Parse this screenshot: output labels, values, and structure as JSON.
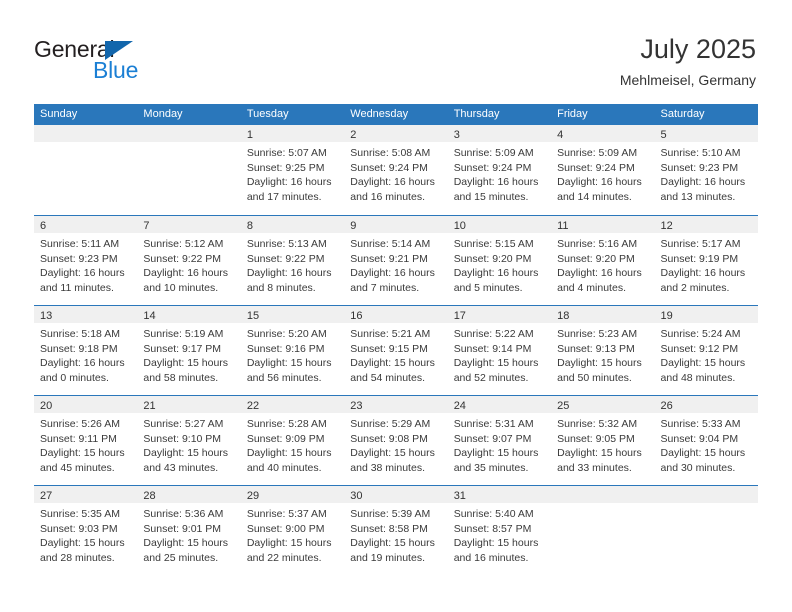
{
  "brand": {
    "name_part1": "General",
    "name_part2": "Blue",
    "flag_icon": "blue-triangle-flag-icon"
  },
  "header": {
    "title": "July 2025",
    "location": "Mehlmeisel, Germany"
  },
  "colors": {
    "header_blue": "#2a77bb",
    "brand_blue": "#1b7fd4",
    "flag_blue": "#1266ac",
    "day_band_gray": "#f0f0f0",
    "text_dark": "#333333"
  },
  "weekdays": [
    "Sunday",
    "Monday",
    "Tuesday",
    "Wednesday",
    "Thursday",
    "Friday",
    "Saturday"
  ],
  "weeks": [
    [
      {
        "day": "",
        "empty": true
      },
      {
        "day": "",
        "empty": true
      },
      {
        "day": "1",
        "sunrise": "Sunrise: 5:07 AM",
        "sunset": "Sunset: 9:25 PM",
        "daylight": "Daylight: 16 hours and 17 minutes."
      },
      {
        "day": "2",
        "sunrise": "Sunrise: 5:08 AM",
        "sunset": "Sunset: 9:24 PM",
        "daylight": "Daylight: 16 hours and 16 minutes."
      },
      {
        "day": "3",
        "sunrise": "Sunrise: 5:09 AM",
        "sunset": "Sunset: 9:24 PM",
        "daylight": "Daylight: 16 hours and 15 minutes."
      },
      {
        "day": "4",
        "sunrise": "Sunrise: 5:09 AM",
        "sunset": "Sunset: 9:24 PM",
        "daylight": "Daylight: 16 hours and 14 minutes."
      },
      {
        "day": "5",
        "sunrise": "Sunrise: 5:10 AM",
        "sunset": "Sunset: 9:23 PM",
        "daylight": "Daylight: 16 hours and 13 minutes."
      }
    ],
    [
      {
        "day": "6",
        "sunrise": "Sunrise: 5:11 AM",
        "sunset": "Sunset: 9:23 PM",
        "daylight": "Daylight: 16 hours and 11 minutes."
      },
      {
        "day": "7",
        "sunrise": "Sunrise: 5:12 AM",
        "sunset": "Sunset: 9:22 PM",
        "daylight": "Daylight: 16 hours and 10 minutes."
      },
      {
        "day": "8",
        "sunrise": "Sunrise: 5:13 AM",
        "sunset": "Sunset: 9:22 PM",
        "daylight": "Daylight: 16 hours and 8 minutes."
      },
      {
        "day": "9",
        "sunrise": "Sunrise: 5:14 AM",
        "sunset": "Sunset: 9:21 PM",
        "daylight": "Daylight: 16 hours and 7 minutes."
      },
      {
        "day": "10",
        "sunrise": "Sunrise: 5:15 AM",
        "sunset": "Sunset: 9:20 PM",
        "daylight": "Daylight: 16 hours and 5 minutes."
      },
      {
        "day": "11",
        "sunrise": "Sunrise: 5:16 AM",
        "sunset": "Sunset: 9:20 PM",
        "daylight": "Daylight: 16 hours and 4 minutes."
      },
      {
        "day": "12",
        "sunrise": "Sunrise: 5:17 AM",
        "sunset": "Sunset: 9:19 PM",
        "daylight": "Daylight: 16 hours and 2 minutes."
      }
    ],
    [
      {
        "day": "13",
        "sunrise": "Sunrise: 5:18 AM",
        "sunset": "Sunset: 9:18 PM",
        "daylight": "Daylight: 16 hours and 0 minutes."
      },
      {
        "day": "14",
        "sunrise": "Sunrise: 5:19 AM",
        "sunset": "Sunset: 9:17 PM",
        "daylight": "Daylight: 15 hours and 58 minutes."
      },
      {
        "day": "15",
        "sunrise": "Sunrise: 5:20 AM",
        "sunset": "Sunset: 9:16 PM",
        "daylight": "Daylight: 15 hours and 56 minutes."
      },
      {
        "day": "16",
        "sunrise": "Sunrise: 5:21 AM",
        "sunset": "Sunset: 9:15 PM",
        "daylight": "Daylight: 15 hours and 54 minutes."
      },
      {
        "day": "17",
        "sunrise": "Sunrise: 5:22 AM",
        "sunset": "Sunset: 9:14 PM",
        "daylight": "Daylight: 15 hours and 52 minutes."
      },
      {
        "day": "18",
        "sunrise": "Sunrise: 5:23 AM",
        "sunset": "Sunset: 9:13 PM",
        "daylight": "Daylight: 15 hours and 50 minutes."
      },
      {
        "day": "19",
        "sunrise": "Sunrise: 5:24 AM",
        "sunset": "Sunset: 9:12 PM",
        "daylight": "Daylight: 15 hours and 48 minutes."
      }
    ],
    [
      {
        "day": "20",
        "sunrise": "Sunrise: 5:26 AM",
        "sunset": "Sunset: 9:11 PM",
        "daylight": "Daylight: 15 hours and 45 minutes."
      },
      {
        "day": "21",
        "sunrise": "Sunrise: 5:27 AM",
        "sunset": "Sunset: 9:10 PM",
        "daylight": "Daylight: 15 hours and 43 minutes."
      },
      {
        "day": "22",
        "sunrise": "Sunrise: 5:28 AM",
        "sunset": "Sunset: 9:09 PM",
        "daylight": "Daylight: 15 hours and 40 minutes."
      },
      {
        "day": "23",
        "sunrise": "Sunrise: 5:29 AM",
        "sunset": "Sunset: 9:08 PM",
        "daylight": "Daylight: 15 hours and 38 minutes."
      },
      {
        "day": "24",
        "sunrise": "Sunrise: 5:31 AM",
        "sunset": "Sunset: 9:07 PM",
        "daylight": "Daylight: 15 hours and 35 minutes."
      },
      {
        "day": "25",
        "sunrise": "Sunrise: 5:32 AM",
        "sunset": "Sunset: 9:05 PM",
        "daylight": "Daylight: 15 hours and 33 minutes."
      },
      {
        "day": "26",
        "sunrise": "Sunrise: 5:33 AM",
        "sunset": "Sunset: 9:04 PM",
        "daylight": "Daylight: 15 hours and 30 minutes."
      }
    ],
    [
      {
        "day": "27",
        "sunrise": "Sunrise: 5:35 AM",
        "sunset": "Sunset: 9:03 PM",
        "daylight": "Daylight: 15 hours and 28 minutes."
      },
      {
        "day": "28",
        "sunrise": "Sunrise: 5:36 AM",
        "sunset": "Sunset: 9:01 PM",
        "daylight": "Daylight: 15 hours and 25 minutes."
      },
      {
        "day": "29",
        "sunrise": "Sunrise: 5:37 AM",
        "sunset": "Sunset: 9:00 PM",
        "daylight": "Daylight: 15 hours and 22 minutes."
      },
      {
        "day": "30",
        "sunrise": "Sunrise: 5:39 AM",
        "sunset": "Sunset: 8:58 PM",
        "daylight": "Daylight: 15 hours and 19 minutes."
      },
      {
        "day": "31",
        "sunrise": "Sunrise: 5:40 AM",
        "sunset": "Sunset: 8:57 PM",
        "daylight": "Daylight: 15 hours and 16 minutes."
      },
      {
        "day": "",
        "empty": true
      },
      {
        "day": "",
        "empty": true
      }
    ]
  ]
}
